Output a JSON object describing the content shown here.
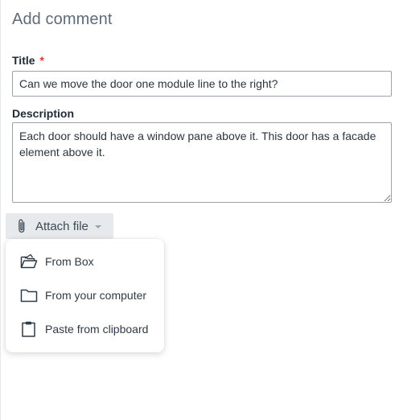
{
  "form": {
    "heading": "Add comment",
    "title_label": "Title",
    "required_mark": "*",
    "title_value": "Can we move the door one module line to the right?",
    "description_label": "Description",
    "description_value": "Each door should have a window pane above it. This door has a facade element above it."
  },
  "attach": {
    "label": "Attach file",
    "menu": [
      {
        "label": "From Box",
        "icon": "folder-open-icon"
      },
      {
        "label": "From your computer",
        "icon": "folder-icon"
      },
      {
        "label": "Paste from clipboard",
        "icon": "clipboard-icon"
      }
    ]
  },
  "colors": {
    "heading": "#5f6b77",
    "required": "#d83a34",
    "button_bg": "#e7eaed",
    "border": "#9aa3ad"
  }
}
